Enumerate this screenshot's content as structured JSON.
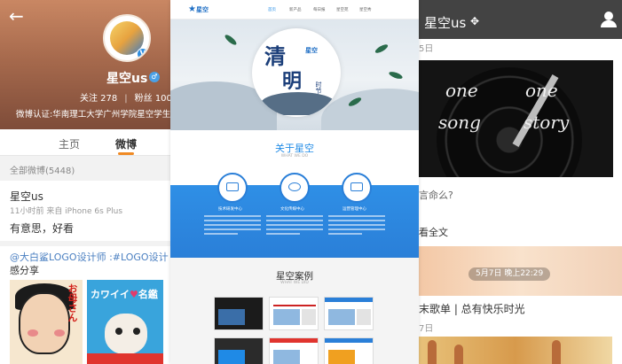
{
  "left": {
    "user_name": "星空us",
    "follow": "关注 278",
    "fans": "粉丝 100",
    "stat_sep": "|",
    "verify": "微博认证:华南理工大学广州学院星空学生",
    "tab_home": "主页",
    "tab_weibo": "微博",
    "all_weibo": "全部微博(5448)",
    "post": {
      "name": "星空us",
      "meta": "11小时前  来自 iPhone 6s Plus",
      "text": "有意思，好看"
    },
    "repost_line1": "@大白鲨LOGO设计师 :#LOGO设计",
    "repost_line2": "感分享",
    "img1_text": "お母さん",
    "img2_text_a": "カワイイ",
    "img2_heart": "♥",
    "img2_text_b": "名鑑"
  },
  "mid": {
    "logo": "星空",
    "nav": [
      "首页",
      "新产品",
      "每日报",
      "星空苑",
      "星空秀"
    ],
    "hero_brush1": "清",
    "hero_brush2": "明",
    "hero_badge": "星空",
    "hero_side": "时节",
    "about_title": "关于星空",
    "about_sub": "WHAT WE DO",
    "features": [
      "技术研发中心",
      "文化传媒中心",
      "运营管理中心"
    ],
    "cases_title": "星空案例",
    "cases_sub": "WHAT WE DID"
  },
  "right": {
    "title": "星空us",
    "date1": "5日",
    "vinyl_words": [
      "one",
      "one",
      "song",
      "story"
    ],
    "question": "言命么?",
    "full": "看全文",
    "date_pill": "5月7日  晚上22:29",
    "song_title": "末歌单 | 总有快乐时光",
    "date2": "7日"
  },
  "colors": {
    "accent": "#1f8ae6",
    "orange": "#f08a24",
    "header_dark": "#434343"
  }
}
